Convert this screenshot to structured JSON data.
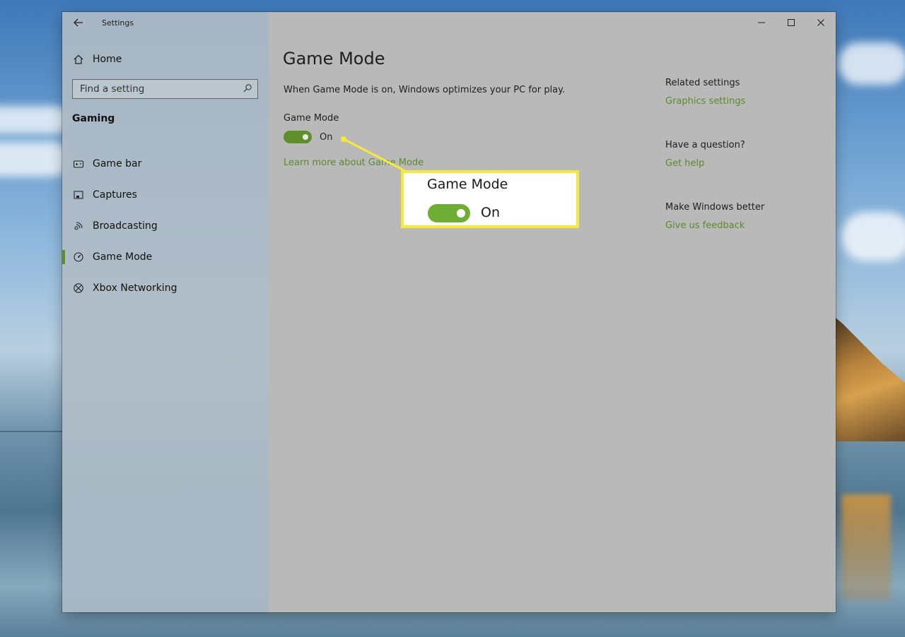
{
  "window": {
    "app_title": "Settings",
    "controls": {
      "minimize": "—",
      "maximize": "☐",
      "close": "✕"
    }
  },
  "sidebar": {
    "home_label": "Home",
    "search_placeholder": "Find a setting",
    "section": "Gaming",
    "items": [
      {
        "label": "Game bar",
        "icon": "game-bar-icon"
      },
      {
        "label": "Captures",
        "icon": "captures-icon"
      },
      {
        "label": "Broadcasting",
        "icon": "broadcasting-icon"
      },
      {
        "label": "Game Mode",
        "icon": "game-mode-icon",
        "active": true
      },
      {
        "label": "Xbox Networking",
        "icon": "xbox-icon"
      }
    ]
  },
  "main": {
    "title": "Game Mode",
    "description": "When Game Mode is on, Windows optimizes your PC for play.",
    "toggle_label": "Game Mode",
    "toggle_state": "On",
    "toggle_on": true,
    "learn_more": "Learn more about Game Mode"
  },
  "related": {
    "related_heading": "Related settings",
    "related_link": "Graphics settings",
    "question_heading": "Have a question?",
    "question_link": "Get help",
    "feedback_heading": "Make Windows better",
    "feedback_link": "Give us feedback"
  },
  "callout": {
    "label": "Game Mode",
    "state": "On"
  },
  "colors": {
    "accent": "#5f8f2a",
    "link": "#5b8a2a",
    "callout_border": "#f5ea3c",
    "callout_toggle": "#6fae35"
  }
}
